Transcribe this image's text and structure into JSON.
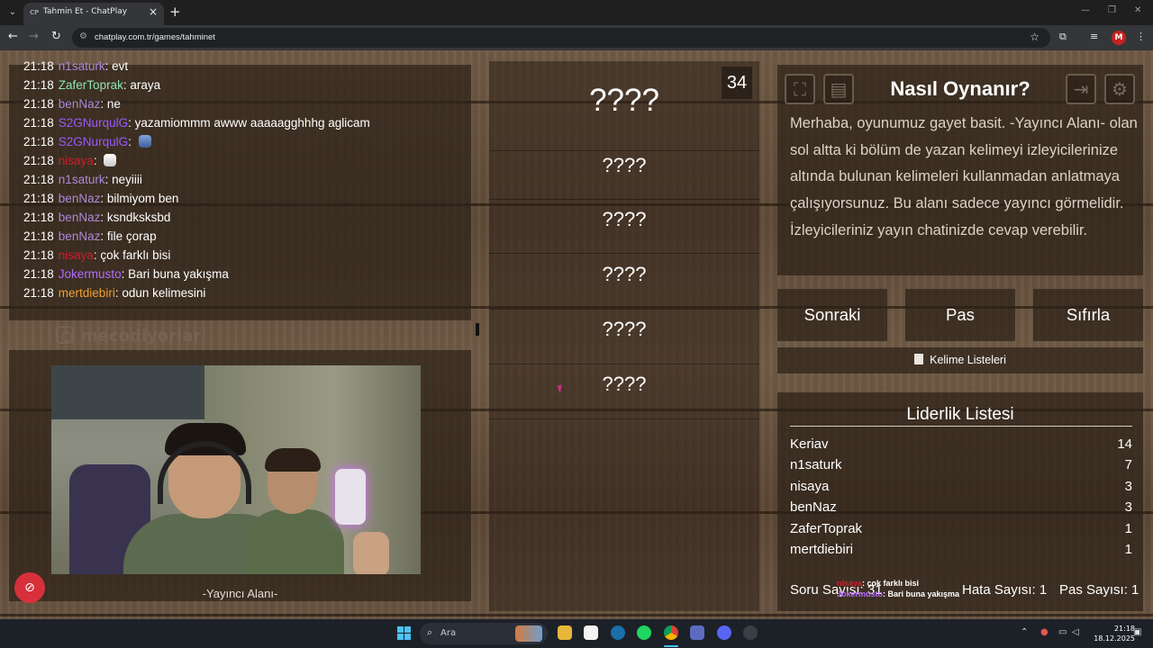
{
  "browser": {
    "tab_title": "Tahmin Et - ChatPlay",
    "tab_favicon": "CP",
    "url": "chatplay.com.tr/games/tahminet",
    "profile_initial": "M",
    "icons": [
      "tab-list-icon",
      "close-icon",
      "plus-icon",
      "minimize-icon",
      "restore-icon",
      "back-icon",
      "forward-icon",
      "reload-icon",
      "site-info-icon",
      "star-icon",
      "extensions-icon",
      "media-icon",
      "menu-icon"
    ]
  },
  "chat": {
    "messages": [
      {
        "time": "21:18",
        "user": "n1saturk",
        "color": "#a98bd8",
        "text": "evt"
      },
      {
        "time": "21:18",
        "user": "ZaferToprak",
        "color": "#8fe3b3",
        "text": "araya"
      },
      {
        "time": "21:18",
        "user": "benNaz",
        "color": "#a98bd8",
        "text": "ne"
      },
      {
        "time": "21:18",
        "user": "S2GNurqulG",
        "color": "#9b59ff",
        "text": "yazamiommm awww aaaaagghhhg aglicam"
      },
      {
        "time": "21:18",
        "user": "S2GNurqulG",
        "color": "#9b59ff",
        "text": "",
        "emote": true
      },
      {
        "time": "21:18",
        "user": "nisaya",
        "color": "#d01f2e",
        "text": "",
        "emote": true
      },
      {
        "time": "21:18",
        "user": "n1saturk",
        "color": "#a98bd8",
        "text": "neyiiii"
      },
      {
        "time": "21:18",
        "user": "benNaz",
        "color": "#a98bd8",
        "text": "bilmiyom ben"
      },
      {
        "time": "21:18",
        "user": "benNaz",
        "color": "#a98bd8",
        "text": "ksndksksbd"
      },
      {
        "time": "21:18",
        "user": "benNaz",
        "color": "#a98bd8",
        "text": "file çorap"
      },
      {
        "time": "21:18",
        "user": "nisaya",
        "color": "#d01f2e",
        "text": "çok farklı bisi"
      },
      {
        "time": "21:18",
        "user": "Jokermusto",
        "color": "#b46cff",
        "text": "Bari buna yakışma"
      },
      {
        "time": "21:18",
        "user": "mertdiebiri",
        "color": "#f0a030",
        "text": "odun kelimesini"
      }
    ]
  },
  "watermark": "mecodiyorlar",
  "streamer_label": "-Yayıncı Alanı-",
  "timer": "34",
  "words": {
    "main": "????",
    "taboo": [
      "????",
      "????",
      "????",
      "????",
      "????"
    ]
  },
  "howto": {
    "title": "Nasıl Oynanır?",
    "text": "Merhaba, oyunumuz gayet basit. -Yayıncı Alanı- olan sol altta ki bölüm de yazan kelimeyi izleyicilerinize altında bulunan kelimeleri kullanmadan anlatmaya çalışıyorsunuz. Bu alanı sadece yayıncı görmelidir. İzleyicileriniz yayın chatinizde cevap verebilir."
  },
  "controls": {
    "next": "Sonraki",
    "pass": "Pas",
    "reset": "Sıfırla",
    "word_lists": "Kelime Listeleri"
  },
  "leaderboard": {
    "title": "Liderlik Listesi",
    "rows": [
      {
        "name": "Keriav",
        "score": "14"
      },
      {
        "name": "n1saturk",
        "score": "7"
      },
      {
        "name": "nisaya",
        "score": "3"
      },
      {
        "name": "benNaz",
        "score": "3"
      },
      {
        "name": "ZaferToprak",
        "score": "1"
      },
      {
        "name": "mertdiebiri",
        "score": "1"
      }
    ],
    "question_count": "Soru Sayısı: 31",
    "error_count": "Hata Sayısı: 1",
    "pass_count": "Pas Sayısı: 1"
  },
  "overlay_chat": [
    {
      "user": "nisaya",
      "text": ": çok farklı bisi"
    },
    {
      "user": "Jokermusto",
      "text": ": Bari buna yakışma"
    }
  ],
  "taskbar": {
    "search_placeholder": "Ara",
    "time": "21:18",
    "date": "18.12.2025"
  }
}
